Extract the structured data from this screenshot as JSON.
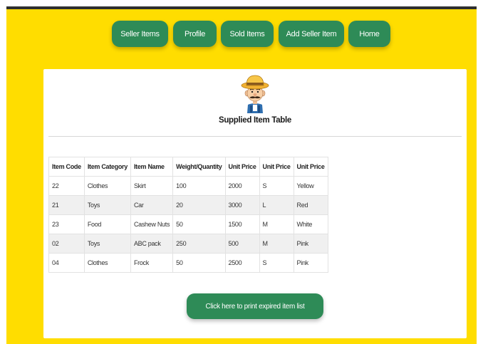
{
  "nav": {
    "items": [
      {
        "label": "Seller Items"
      },
      {
        "label": "Profile"
      },
      {
        "label": "Sold Items"
      },
      {
        "label": "Add Seller Item"
      },
      {
        "label": "Home"
      }
    ]
  },
  "main": {
    "title": "Supplied Item Table",
    "avatar_icon": "farmer-avatar-icon",
    "table": {
      "headers": [
        "Item Code",
        "Item Category",
        "Item Name",
        "Weight/Quantity",
        "Unit Price",
        "Unit Price",
        "Unit Price"
      ],
      "rows": [
        [
          "22",
          "Clothes",
          "Skirt",
          "100",
          "2000",
          "S",
          "Yellow"
        ],
        [
          "21",
          "Toys",
          "Car",
          "20",
          "3000",
          "L",
          "Red"
        ],
        [
          "23",
          "Food",
          "Cashew Nuts",
          "50",
          "1500",
          "M",
          "White"
        ],
        [
          "02",
          "Toys",
          "ABC pack",
          "250",
          "500",
          "M",
          "Pink"
        ],
        [
          "04",
          "Clothes",
          "Frock",
          "50",
          "2500",
          "S",
          "Pink"
        ]
      ]
    },
    "print_button_label": "Click here to print expired item list"
  },
  "colors": {
    "background": "#ffdd00",
    "button": "#2e8b57",
    "top_bar": "#2f2f2f"
  }
}
